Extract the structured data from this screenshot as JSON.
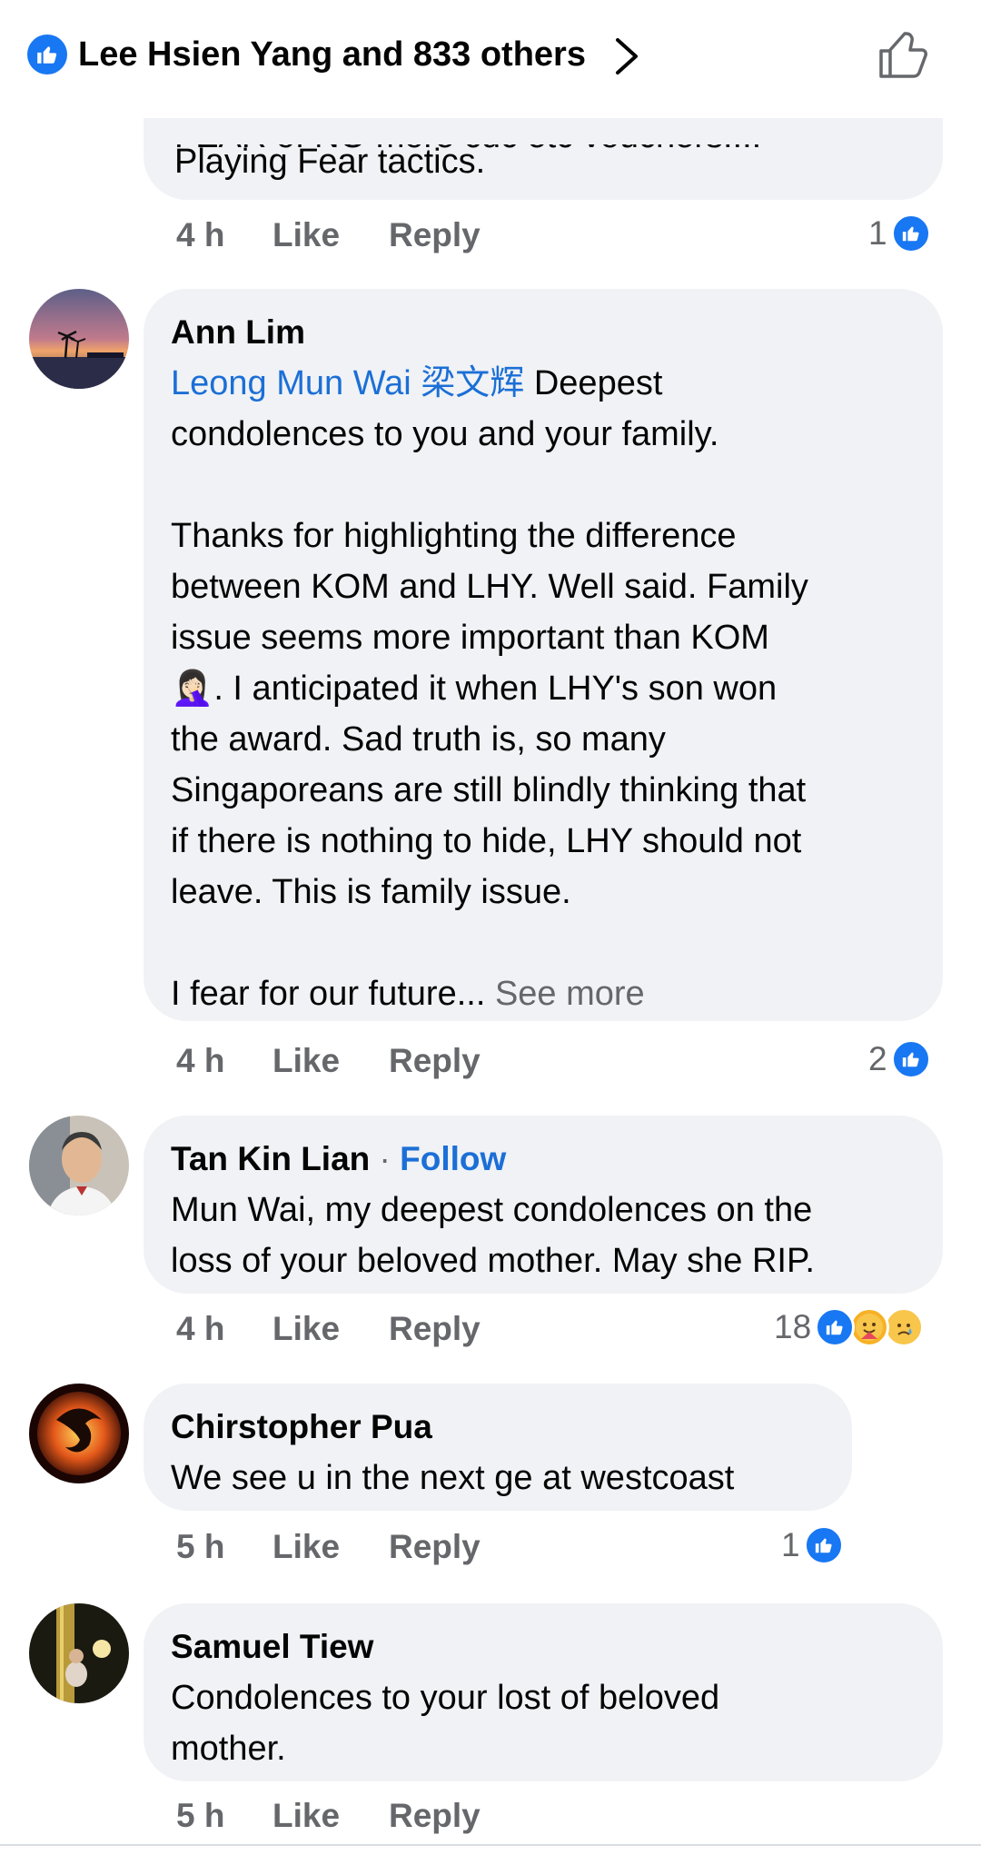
{
  "header": {
    "likers_text": "Lee Hsien Yang and 833 others"
  },
  "comments": [
    {
      "partial_text_top": "FEAR of  NO more cdc etc vouchers....",
      "text_last_line": "Playing Fear tactics.",
      "time": "4 h",
      "like": "Like",
      "reply": "Reply",
      "reaction_count": "1"
    },
    {
      "author": "Ann Lim",
      "mention": "Leong Mun Wai 梁文辉",
      "text_after_mention": " Deepest",
      "paragraph1": "condolences to you and your family.",
      "paragraph2": "Thanks for highlighting the difference\nbetween KOM and LHY. Well said.   Family\nissue seems more important than KOM",
      "emoji_line": "🤦🏻‍♀️. I anticipated it when LHY's son won",
      "paragraph3": "the award. Sad truth is, so many\nSingaporeans are still blindly thinking that\nif there is nothing to hide, LHY should not\nleave. This is family issue.",
      "paragraph4": " I fear for our future... ",
      "see_more": "See more",
      "time": "4 h",
      "like": "Like",
      "reply": "Reply",
      "reaction_count": "2"
    },
    {
      "author": "Tan Kin Lian",
      "follow_sep": " · ",
      "follow": "Follow",
      "text": "Mun Wai, my deepest condolences on the\nloss of your beloved mother. May she RIP.",
      "time": "4 h",
      "like": "Like",
      "reply": "Reply",
      "reaction_count": "18"
    },
    {
      "author": "Chirstopher Pua",
      "text": "We see u in the next ge at westcoast",
      "time": "5 h",
      "like": "Like",
      "reply": "Reply",
      "reaction_count": "1"
    },
    {
      "author": "Samuel Tiew",
      "text": "Condolences to your lost of beloved\nmother.",
      "time": "5 h",
      "like": "Like",
      "reply": "Reply"
    }
  ],
  "colors": {
    "accent": "#1877f2",
    "bubble": "#f0f2f5",
    "muted": "#65676b",
    "mention": "#1b6fd6"
  },
  "icons": [
    "like-badge-icon",
    "chevron-right-icon",
    "thumbs-up-outline-icon",
    "like-reaction-icon",
    "care-reaction-icon",
    "sad-reaction-icon"
  ]
}
